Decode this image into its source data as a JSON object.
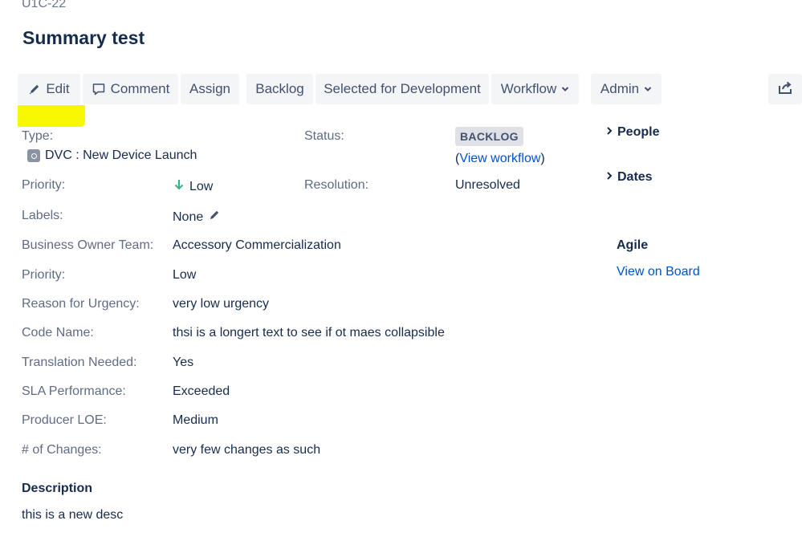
{
  "issue": {
    "key": "U1C-22",
    "title": "Summary test"
  },
  "toolbar": {
    "edit": "Edit",
    "comment": "Comment",
    "assign": "Assign",
    "backlog": "Backlog",
    "selected": "Selected for Development",
    "workflow": "Workflow",
    "admin": "Admin"
  },
  "fields": {
    "type_label": "Type:",
    "type_value": "DVC : New Device Launch",
    "status_label": "Status:",
    "status_value": "BACKLOG",
    "view_workflow_open": "(",
    "view_workflow": "View workflow",
    "view_workflow_close": ")",
    "priority_label": "Priority:",
    "priority_value": "Low",
    "resolution_label": "Resolution:",
    "resolution_value": "Unresolved",
    "labels_label": "Labels:",
    "labels_value": "None"
  },
  "custom_fields": [
    {
      "label": "Business Owner Team:",
      "value": "Accessory Commercialization"
    },
    {
      "label": "Priority:",
      "value": "Low"
    },
    {
      "label": "Reason for Urgency:",
      "value": "very low urgency"
    },
    {
      "label": "Code Name:",
      "value": "thsi is a longert text to see if ot maes collapsible"
    },
    {
      "label": "Translation Needed:",
      "value": "Yes"
    },
    {
      "label": "SLA Performance:",
      "value": "Exceeded"
    },
    {
      "label": "Producer LOE:",
      "value": "Medium"
    },
    {
      "label": "# of Changes:",
      "value": "very few changes as such"
    }
  ],
  "sidebar": {
    "people": "People",
    "dates": "Dates",
    "agile": "Agile",
    "view_on_board": "View on Board"
  },
  "description": {
    "heading": "Description",
    "body": "this is a new desc"
  },
  "colors": {
    "link": "#0052cc",
    "highlight": "#f7f700",
    "priority_low": "#36b37e",
    "button_bg": "#f4f5f7"
  },
  "icons": [
    "pencil-icon",
    "comment-icon",
    "chevron-down-icon",
    "share-icon",
    "arrow-down-icon",
    "chevron-right-icon",
    "type-icon"
  ]
}
